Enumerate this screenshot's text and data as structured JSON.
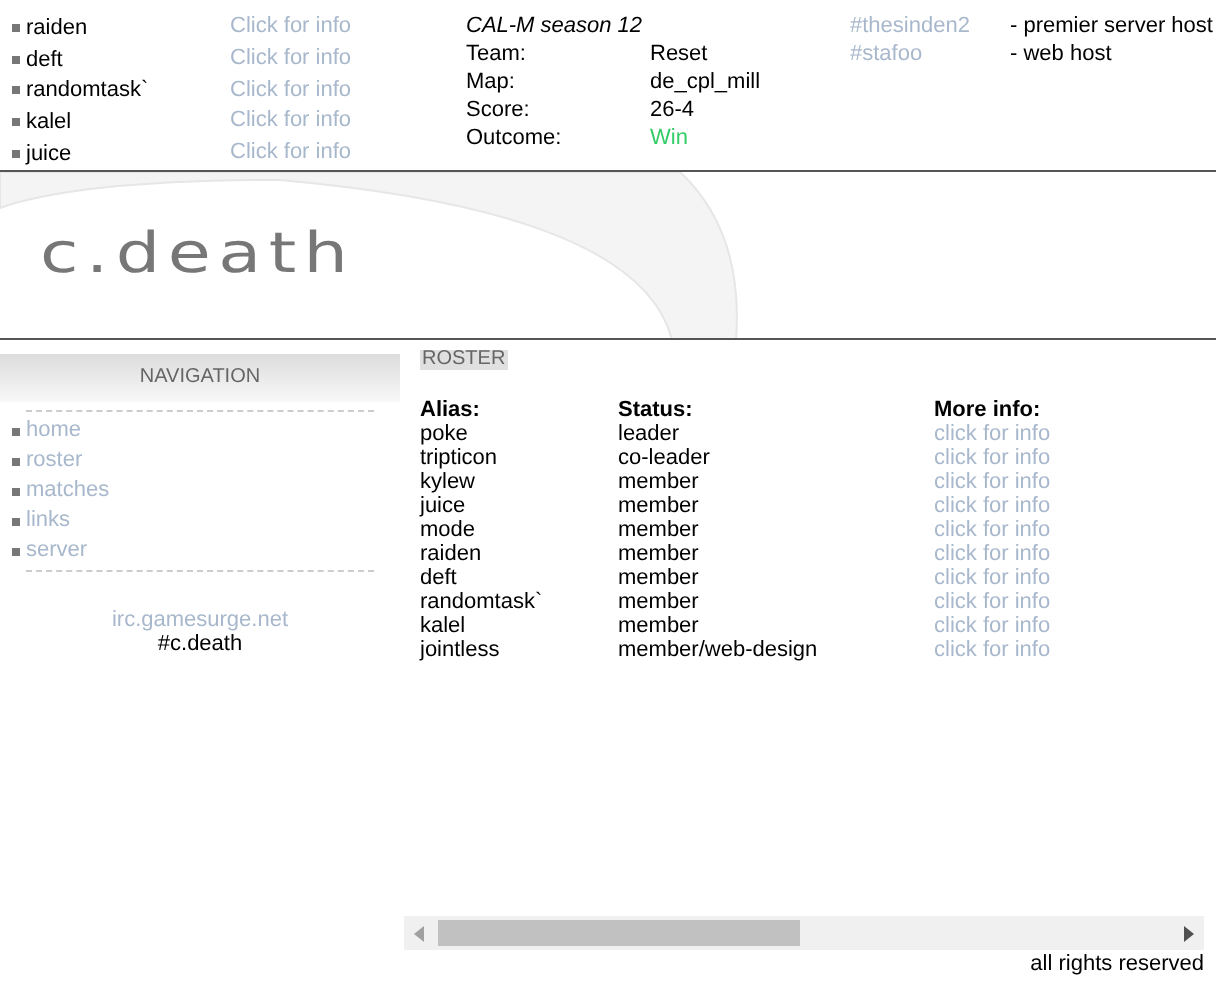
{
  "top_players": [
    {
      "name": "raiden",
      "link": "Click for info"
    },
    {
      "name": "deft",
      "link": "Click for info"
    },
    {
      "name": "randomtask`",
      "link": "Click for info"
    },
    {
      "name": "kalel",
      "link": "Click for info"
    },
    {
      "name": "juice",
      "link": "Click for info"
    }
  ],
  "match": {
    "title": "CAL-M season 12",
    "fields": [
      {
        "label": "Team:",
        "value": "Reset",
        "kind": "plain"
      },
      {
        "label": "Map:",
        "value": "de_cpl_mill",
        "kind": "plain"
      },
      {
        "label": "Score:",
        "value": "26-4",
        "kind": "plain"
      },
      {
        "label": "Outcome:",
        "value": "Win",
        "kind": "win"
      }
    ]
  },
  "hosts": [
    {
      "channel": "#thesinden2",
      "role": "- premier server host"
    },
    {
      "channel": "#stafoo",
      "role": "- web host"
    }
  ],
  "logo": "c.death",
  "navigation": {
    "title": "NAVIGATION",
    "items": [
      "home",
      "roster",
      "matches",
      "links",
      "server"
    ],
    "irc_server": "irc.gamesurge.net",
    "irc_channel": "#c.death"
  },
  "roster": {
    "title": "ROSTER",
    "columns": [
      "Alias:",
      "Status:",
      "More info:"
    ],
    "rows": [
      [
        "poke",
        "leader",
        "click for info"
      ],
      [
        "tripticon",
        "co-leader",
        "click for info"
      ],
      [
        "kylew",
        "member",
        "click for info"
      ],
      [
        "juice",
        "member",
        "click for info"
      ],
      [
        "mode",
        "member",
        "click for info"
      ],
      [
        "raiden",
        "member",
        "click for info"
      ],
      [
        "deft",
        "member",
        "click for info"
      ],
      [
        "randomtask`",
        "member",
        "click for info"
      ],
      [
        "kalel",
        "member",
        "click for info"
      ],
      [
        "jointless",
        "member/web-design",
        "click for info"
      ]
    ]
  },
  "footer": "all rights reserved"
}
